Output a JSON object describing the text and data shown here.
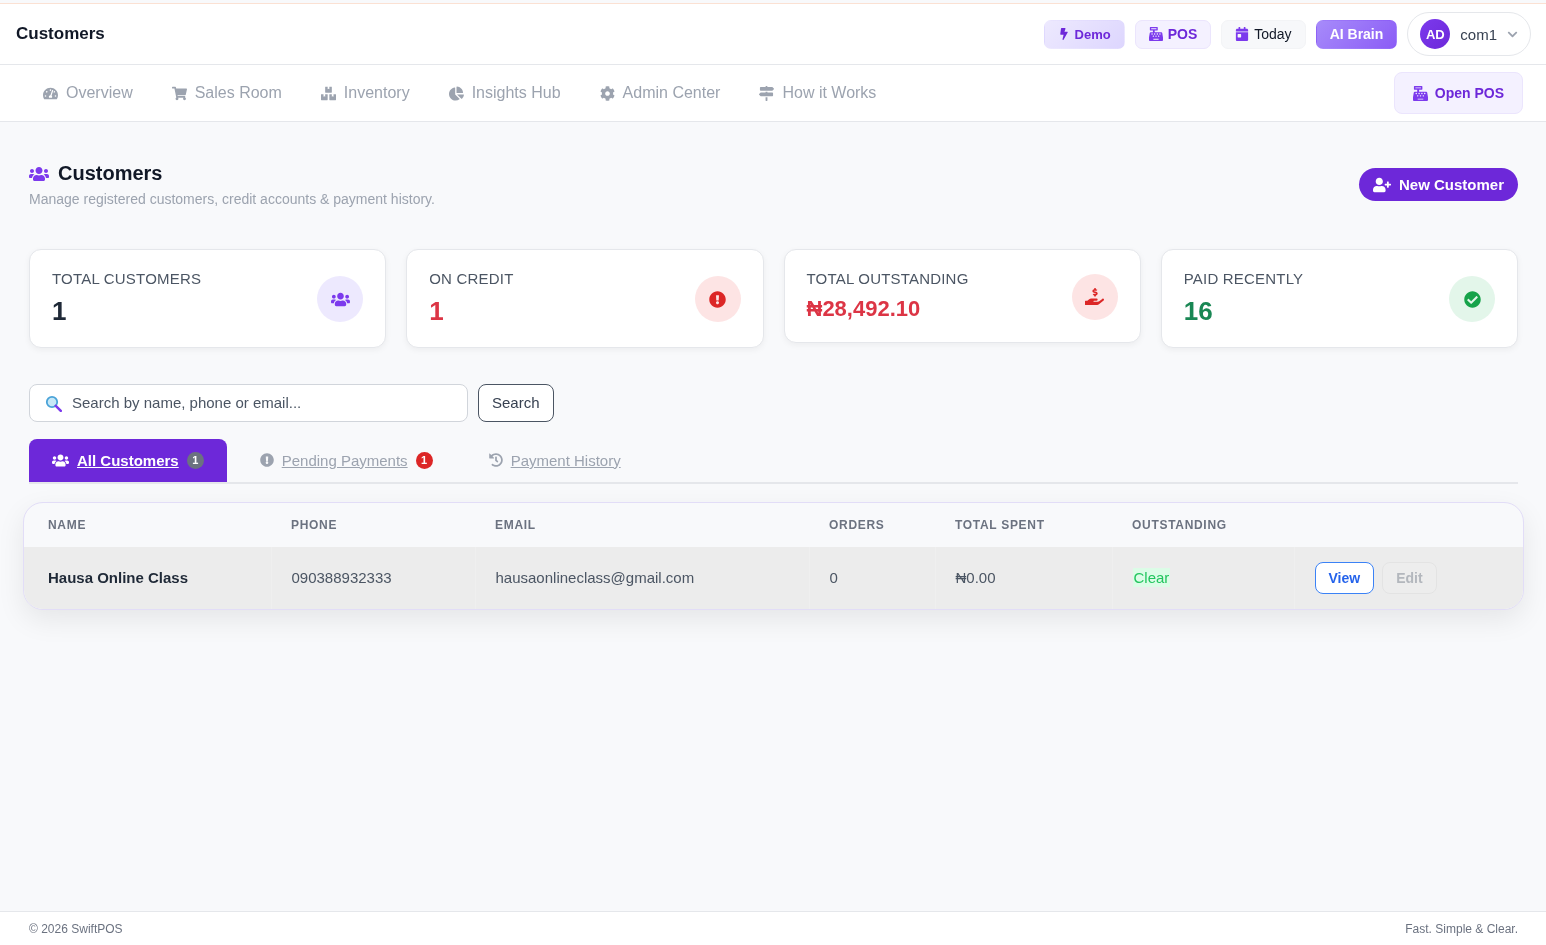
{
  "header": {
    "title": "Customers",
    "buttons": [
      {
        "label": "Demo",
        "kind": "soft"
      },
      {
        "label": "POS",
        "kind": "tint"
      },
      {
        "label": "Today",
        "kind": "plain"
      },
      {
        "label": "AI Brain",
        "kind": "solid"
      }
    ],
    "user": {
      "initials": "AD",
      "name": "com1"
    }
  },
  "nav": {
    "items": [
      {
        "label": "Overview"
      },
      {
        "label": "Sales Room"
      },
      {
        "label": "Inventory"
      },
      {
        "label": "Insights Hub"
      },
      {
        "label": "Admin Center"
      },
      {
        "label": "How it Works"
      }
    ],
    "open_pos": "Open POS"
  },
  "page": {
    "title": "Customers",
    "subtitle": "Manage registered customers, credit accounts & payment history.",
    "new_button": "New Customer"
  },
  "stats": [
    {
      "kind": "total",
      "label": "TOTAL CUSTOMERS",
      "value": "1"
    },
    {
      "kind": "credit",
      "label": "ON CREDIT",
      "value": "1"
    },
    {
      "kind": "outstanding",
      "label": "TOTAL OUTSTANDING",
      "value": "₦28,492.10"
    },
    {
      "kind": "paid",
      "label": "PAID RECENTLY",
      "value": "16"
    }
  ],
  "search": {
    "placeholder": "Search by name, phone or email...",
    "button": "Search"
  },
  "tabs": [
    {
      "label": "All Customers",
      "selected": true,
      "badge": {
        "text": "1",
        "color": "#6b7280"
      }
    },
    {
      "label": "Pending Payments",
      "selected": false,
      "badge": {
        "text": "1",
        "color": "#dc2626"
      }
    },
    {
      "label": "Payment History",
      "selected": false
    }
  ],
  "table": {
    "columns": [
      "NAME",
      "PHONE",
      "EMAIL",
      "ORDERS",
      "TOTAL SPENT",
      "OUTSTANDING"
    ],
    "rows": [
      {
        "name": "Hausa Online Class",
        "phone": "090388932333",
        "email": "hausaonlineclass@gmail.com",
        "orders": "0",
        "total_spent": "₦0.00",
        "outstanding": {
          "text": "Clear",
          "kind": "clear"
        },
        "actions": [
          {
            "label": "View",
            "disabled": false
          },
          {
            "label": "Edit",
            "disabled": true
          }
        ]
      }
    ]
  },
  "footer": {
    "left": "© 2026 SwiftPOS",
    "right": "Fast. Simple & Clear."
  }
}
